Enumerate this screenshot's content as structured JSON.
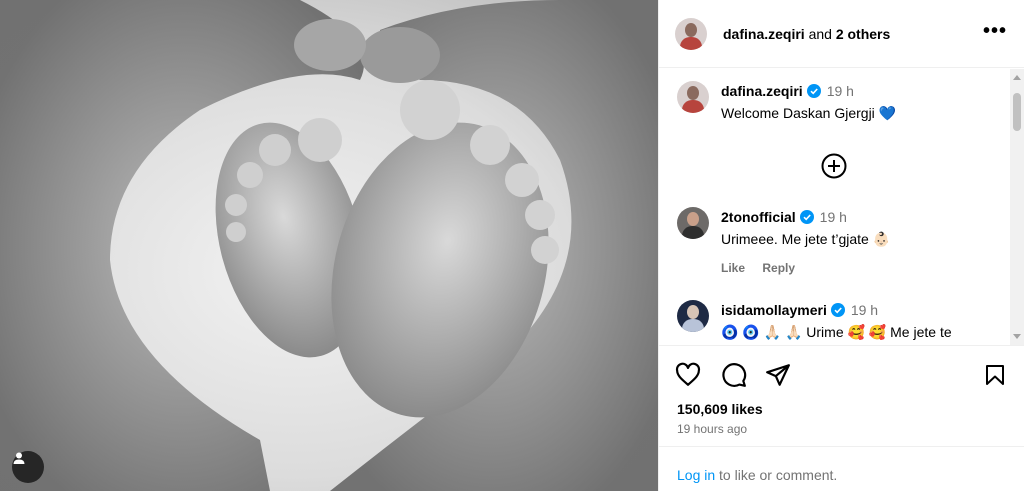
{
  "header": {
    "username": "dafina.zeqiri",
    "and_text": "and",
    "others": "2 others",
    "more": "•••"
  },
  "comments": [
    {
      "username": "dafina.zeqiri",
      "time": "19 h",
      "text": "Welcome Daskan Gjergji 💙"
    },
    {
      "username": "2tonofficial",
      "time": "19 h",
      "text": "Urimeee. Me jete t’gjate 👶🏻",
      "like": "Like",
      "reply": "Reply"
    },
    {
      "username": "isidamollaymeri",
      "time": "19 h",
      "text": "🧿 🧿 🙏🏻 🙏🏻 Urime 🥰 🥰 Me jete te"
    }
  ],
  "footer": {
    "likes": "150,609 likes",
    "time_ago": "19 hours ago",
    "login_link": "Log in",
    "login_rest": "to like or comment."
  },
  "colors": {
    "link": "#0095f6",
    "muted": "#737373",
    "verified": "#0095f6"
  }
}
